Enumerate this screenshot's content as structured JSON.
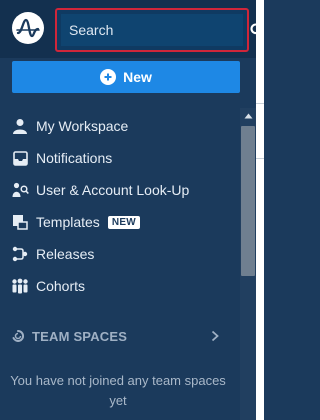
{
  "header": {
    "logo_icon": "amplitude-logo-icon",
    "search": {
      "placeholder": "Search",
      "icon": "search-icon"
    }
  },
  "new_button": {
    "label": "New",
    "icon": "plus-circle-icon",
    "color": "#1e88e5"
  },
  "nav": {
    "items": [
      {
        "label": "My Workspace",
        "icon": "user-icon"
      },
      {
        "label": "Notifications",
        "icon": "inbox-icon"
      },
      {
        "label": "User & Account Look-Up",
        "icon": "user-search-icon"
      },
      {
        "label": "Templates",
        "icon": "templates-icon",
        "badge": "NEW"
      },
      {
        "label": "Releases",
        "icon": "releases-icon"
      },
      {
        "label": "Cohorts",
        "icon": "cohorts-icon"
      }
    ]
  },
  "team_spaces": {
    "title": "TEAM SPACES",
    "icon": "team-spaces-icon",
    "chevron_icon": "chevron-right-icon",
    "empty_message": "You have not joined any team spaces yet"
  },
  "colors": {
    "sidebar_bg": "#1b3a5c",
    "search_border": "#d0263a",
    "accent": "#1e88e5"
  }
}
